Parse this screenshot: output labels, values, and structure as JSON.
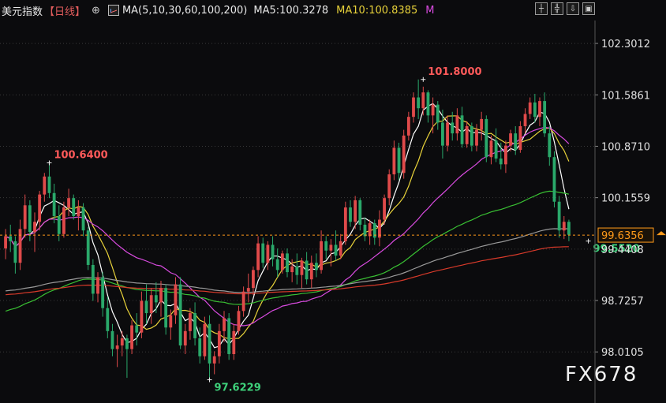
{
  "header": {
    "title": "美元指数",
    "period": "【日线】",
    "settings_glyph": "⊕",
    "ma_label": "MA(5,10,30,60,100,200)",
    "ma5": "MA5:100.3278",
    "ma10": "MA10:100.8385",
    "more": "M"
  },
  "toolbar": {
    "icons": [
      "crosshair-icon",
      "zoom-icon",
      "export-icon",
      "fullscreen-icon"
    ],
    "glyphs": [
      "┼",
      "╬",
      "⇩",
      "▣"
    ]
  },
  "watermark": "FX678",
  "colors": {
    "up": "#e04a4a",
    "down": "#2aa86a",
    "ma5": "#ffffff",
    "ma10": "#e8d23a",
    "ma30": "#d94be0",
    "ma60": "#39c033",
    "ma100": "#9a9a9a",
    "ma200": "#d83a2a",
    "last": "#ff9a1a"
  },
  "chart_data": {
    "type": "candlestick",
    "ylim": [
      97.3,
      102.62
    ],
    "yticks": [
      "102.3012",
      "101.5861",
      "100.8710",
      "100.1559",
      "99.4408",
      "98.7257",
      "98.0105"
    ],
    "last_price": "99.6356",
    "annotations": [
      {
        "label": "101.8000",
        "index": 86,
        "value": 101.8
      },
      {
        "label": "100.6400",
        "index": 9,
        "value": 100.64
      },
      {
        "label": "97.6229",
        "index": 42,
        "value": 97.6229
      },
      {
        "label": "99.5520",
        "index": 120,
        "value": 99.552
      }
    ],
    "ohlc": [
      [
        99.45,
        99.72,
        99.3,
        99.62
      ],
      [
        99.62,
        99.78,
        99.4,
        99.55
      ],
      [
        99.55,
        99.62,
        99.1,
        99.25
      ],
      [
        99.25,
        99.85,
        99.15,
        99.72
      ],
      [
        99.72,
        100.2,
        99.6,
        100.05
      ],
      [
        100.05,
        100.12,
        99.55,
        99.68
      ],
      [
        99.68,
        99.95,
        99.4,
        99.82
      ],
      [
        99.82,
        100.25,
        99.7,
        100.2
      ],
      [
        100.2,
        100.5,
        100.1,
        100.45
      ],
      [
        100.45,
        100.64,
        100.15,
        100.22
      ],
      [
        100.22,
        100.35,
        99.8,
        99.9
      ],
      [
        99.9,
        100.05,
        99.55,
        99.65
      ],
      [
        99.65,
        100.1,
        99.6,
        100.02
      ],
      [
        100.02,
        100.28,
        99.9,
        100.15
      ],
      [
        100.15,
        100.2,
        99.85,
        99.9
      ],
      [
        99.9,
        100.12,
        99.7,
        100.02
      ],
      [
        100.02,
        100.08,
        99.62,
        99.7
      ],
      [
        99.7,
        99.75,
        99.15,
        99.22
      ],
      [
        99.22,
        99.3,
        98.72,
        98.82
      ],
      [
        98.82,
        99.12,
        98.7,
        99.05
      ],
      [
        99.05,
        99.12,
        98.5,
        98.62
      ],
      [
        98.62,
        98.78,
        98.2,
        98.3
      ],
      [
        98.3,
        98.4,
        97.95,
        98.05
      ],
      [
        98.05,
        98.25,
        97.8,
        98.1
      ],
      [
        98.1,
        98.3,
        97.95,
        98.2
      ],
      [
        98.2,
        98.25,
        97.65,
        98.05
      ],
      [
        98.05,
        98.45,
        97.98,
        98.38
      ],
      [
        98.38,
        98.55,
        98.1,
        98.28
      ],
      [
        98.28,
        98.85,
        98.2,
        98.72
      ],
      [
        98.72,
        98.95,
        98.4,
        98.55
      ],
      [
        98.55,
        98.9,
        98.4,
        98.8
      ],
      [
        98.8,
        98.98,
        98.55,
        98.7
      ],
      [
        98.7,
        99.0,
        98.5,
        98.9
      ],
      [
        98.9,
        98.95,
        98.25,
        98.35
      ],
      [
        98.35,
        98.6,
        98.18,
        98.52
      ],
      [
        98.52,
        99.05,
        98.4,
        98.95
      ],
      [
        98.95,
        99.05,
        98.05,
        98.1
      ],
      [
        98.1,
        98.4,
        97.98,
        98.3
      ],
      [
        98.3,
        98.62,
        98.18,
        98.55
      ],
      [
        98.55,
        98.7,
        98.1,
        98.2
      ],
      [
        98.2,
        98.35,
        97.85,
        97.95
      ],
      [
        97.95,
        98.5,
        97.9,
        98.4
      ],
      [
        98.4,
        98.52,
        97.62,
        97.85
      ],
      [
        97.85,
        98.02,
        97.7,
        97.95
      ],
      [
        97.95,
        98.4,
        97.85,
        98.3
      ],
      [
        98.3,
        98.58,
        98.15,
        98.48
      ],
      [
        98.48,
        98.55,
        97.9,
        97.98
      ],
      [
        97.98,
        98.4,
        97.9,
        98.3
      ],
      [
        98.3,
        98.65,
        98.25,
        98.58
      ],
      [
        98.58,
        98.92,
        98.5,
        98.85
      ],
      [
        98.85,
        99.1,
        98.7,
        98.9
      ],
      [
        98.9,
        99.2,
        98.8,
        99.15
      ],
      [
        99.15,
        99.62,
        99.05,
        99.52
      ],
      [
        99.52,
        99.6,
        99.18,
        99.25
      ],
      [
        99.25,
        99.55,
        99.15,
        99.5
      ],
      [
        99.5,
        99.62,
        99.2,
        99.3
      ],
      [
        99.3,
        99.45,
        99.05,
        99.15
      ],
      [
        99.15,
        99.42,
        99.1,
        99.38
      ],
      [
        99.38,
        99.45,
        99.05,
        99.12
      ],
      [
        99.12,
        99.3,
        98.98,
        99.2
      ],
      [
        99.2,
        99.38,
        98.95,
        99.08
      ],
      [
        99.08,
        99.32,
        98.9,
        99.28
      ],
      [
        99.28,
        99.4,
        98.95,
        99.02
      ],
      [
        99.02,
        99.35,
        98.9,
        99.25
      ],
      [
        99.25,
        99.38,
        99.05,
        99.15
      ],
      [
        99.15,
        99.7,
        99.1,
        99.55
      ],
      [
        99.55,
        99.62,
        99.3,
        99.42
      ],
      [
        99.42,
        99.58,
        99.2,
        99.5
      ],
      [
        99.5,
        99.7,
        99.28,
        99.35
      ],
      [
        99.35,
        99.65,
        99.3,
        99.55
      ],
      [
        99.55,
        100.1,
        99.5,
        100.02
      ],
      [
        100.02,
        100.12,
        99.75,
        99.82
      ],
      [
        99.82,
        100.18,
        99.72,
        100.12
      ],
      [
        100.12,
        100.15,
        99.7,
        99.78
      ],
      [
        99.78,
        99.88,
        99.55,
        99.62
      ],
      [
        99.62,
        99.85,
        99.5,
        99.8
      ],
      [
        99.8,
        99.85,
        99.5,
        99.6
      ],
      [
        99.6,
        99.98,
        99.48,
        99.85
      ],
      [
        99.85,
        100.2,
        99.78,
        100.15
      ],
      [
        100.15,
        100.55,
        100.05,
        100.48
      ],
      [
        100.48,
        100.95,
        100.4,
        100.85
      ],
      [
        100.85,
        100.92,
        100.4,
        100.5
      ],
      [
        100.5,
        101.1,
        100.42,
        101.02
      ],
      [
        101.02,
        101.35,
        100.95,
        101.28
      ],
      [
        101.28,
        101.62,
        101.2,
        101.55
      ],
      [
        101.55,
        101.8,
        101.25,
        101.4
      ],
      [
        101.4,
        101.7,
        101.3,
        101.62
      ],
      [
        101.62,
        101.65,
        101.2,
        101.3
      ],
      [
        101.3,
        101.55,
        101.05,
        101.45
      ],
      [
        101.45,
        101.5,
        101.1,
        101.2
      ],
      [
        101.2,
        101.38,
        100.7,
        100.88
      ],
      [
        100.88,
        101.3,
        100.8,
        101.2
      ],
      [
        101.2,
        101.35,
        100.95,
        101.05
      ],
      [
        101.05,
        101.4,
        100.95,
        101.3
      ],
      [
        101.3,
        101.42,
        100.85,
        100.9
      ],
      [
        100.9,
        101.22,
        100.85,
        101.15
      ],
      [
        101.15,
        101.2,
        100.8,
        100.88
      ],
      [
        100.88,
        101.18,
        100.8,
        101.1
      ],
      [
        101.1,
        101.35,
        100.95,
        101.25
      ],
      [
        101.25,
        101.3,
        100.65,
        100.72
      ],
      [
        100.72,
        101.02,
        100.62,
        100.95
      ],
      [
        100.95,
        101.12,
        100.65,
        100.7
      ],
      [
        100.7,
        100.92,
        100.55,
        100.62
      ],
      [
        100.62,
        100.95,
        100.5,
        100.88
      ],
      [
        100.88,
        101.1,
        100.8,
        101.05
      ],
      [
        101.05,
        101.15,
        100.75,
        100.82
      ],
      [
        100.82,
        101.22,
        100.78,
        101.15
      ],
      [
        101.15,
        101.4,
        101.05,
        101.32
      ],
      [
        101.32,
        101.55,
        101.25,
        101.48
      ],
      [
        101.48,
        101.6,
        101.2,
        101.28
      ],
      [
        101.28,
        101.55,
        101.15,
        101.5
      ],
      [
        101.5,
        101.62,
        101.0,
        101.05
      ],
      [
        101.05,
        101.15,
        100.6,
        100.72
      ],
      [
        100.72,
        100.8,
        100.02,
        100.1
      ],
      [
        100.1,
        100.18,
        99.6,
        99.7
      ],
      [
        99.7,
        99.9,
        99.58,
        99.82
      ],
      [
        99.82,
        99.85,
        99.55,
        99.64
      ]
    ]
  }
}
